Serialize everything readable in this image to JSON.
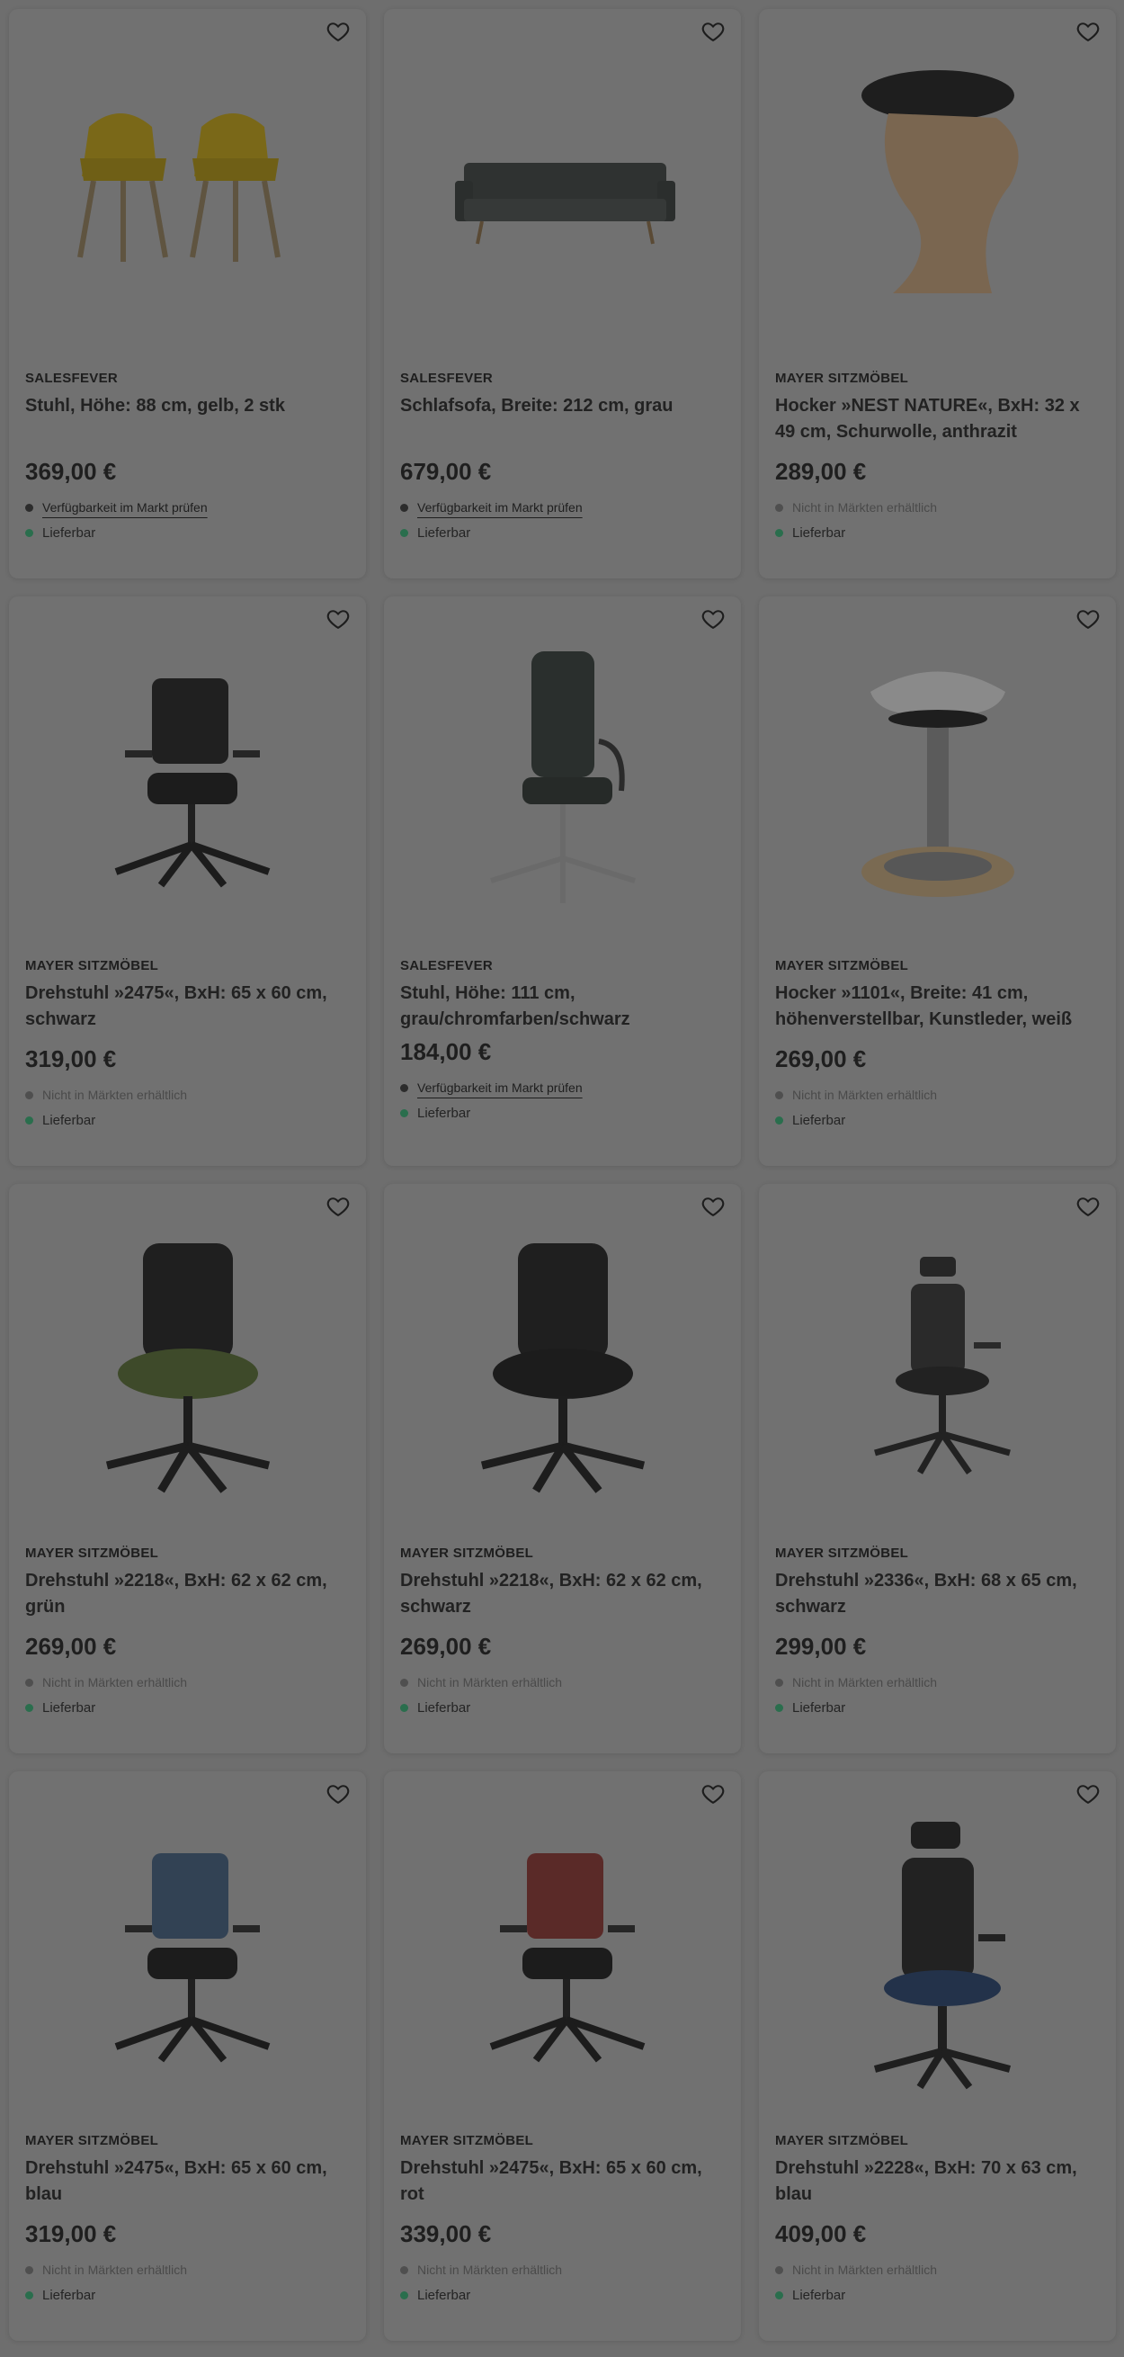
{
  "products": [
    {
      "brand": "SALESFEVER",
      "title": "Stuhl, Höhe: 88 cm, gelb, 2 stk",
      "price": "369,00 €",
      "availability": "Verfügbarkeit im Markt prüfen",
      "availability_type": "check",
      "delivery": "Lieferbar",
      "image": "yellow-armchair-pair"
    },
    {
      "brand": "SALESFEVER",
      "title": "Schlafsofa, Breite: 212 cm, grau",
      "price": "679,00 €",
      "availability": "Verfügbarkeit im Markt prüfen",
      "availability_type": "check",
      "delivery": "Lieferbar",
      "image": "grey-sofa-bed"
    },
    {
      "brand": "MAYER SITZMÖBEL",
      "title": "Hocker »NEST NATURE«, BxH: 32 x 49 cm, Schurwolle, anthrazit",
      "price": "289,00 €",
      "availability": "Nicht in Märkten erhältlich",
      "availability_type": "none",
      "delivery": "Lieferbar",
      "image": "wooden-stool"
    },
    {
      "brand": "MAYER SITZMÖBEL",
      "title": "Drehstuhl »2475«, BxH: 65 x 60 cm, schwarz",
      "price": "319,00 €",
      "availability": "Nicht in Märkten erhältlich",
      "availability_type": "none",
      "delivery": "Lieferbar",
      "image": "office-chair-black"
    },
    {
      "brand": "SALESFEVER",
      "title": "Stuhl, Höhe: 111 cm, grau/chromfarben/schwarz",
      "price": "184,00 €",
      "availability": "Verfügbarkeit im Markt prüfen",
      "availability_type": "check",
      "delivery": "Lieferbar",
      "image": "office-chair-highback-chrome"
    },
    {
      "brand": "MAYER SITZMÖBEL",
      "title": "Hocker »1101«, Breite: 41 cm, höhenverstellbar, Kunstleder, weiß",
      "price": "269,00 €",
      "availability": "Nicht in Märkten erhältlich",
      "availability_type": "none",
      "delivery": "Lieferbar",
      "image": "saddle-stool-white"
    },
    {
      "brand": "MAYER SITZMÖBEL",
      "title": "Drehstuhl »2218«, BxH: 62 x 62 cm, grün",
      "price": "269,00 €",
      "availability": "Nicht in Märkten erhältlich",
      "availability_type": "none",
      "delivery": "Lieferbar",
      "image": "office-chair-green"
    },
    {
      "brand": "MAYER SITZMÖBEL",
      "title": "Drehstuhl »2218«, BxH: 62 x 62 cm, schwarz",
      "price": "269,00 €",
      "availability": "Nicht in Märkten erhältlich",
      "availability_type": "none",
      "delivery": "Lieferbar",
      "image": "office-chair-black-mesh"
    },
    {
      "brand": "MAYER SITZMÖBEL",
      "title": "Drehstuhl »2336«, BxH: 68 x 65 cm, schwarz",
      "price": "299,00 €",
      "availability": "Nicht in Märkten erhältlich",
      "availability_type": "none",
      "delivery": "Lieferbar",
      "image": "office-chair-headrest-black"
    },
    {
      "brand": "MAYER SITZMÖBEL",
      "title": "Drehstuhl »2475«, BxH: 65 x 60 cm, blau",
      "price": "319,00 €",
      "availability": "Nicht in Märkten erhältlich",
      "availability_type": "none",
      "delivery": "Lieferbar",
      "image": "office-chair-blue-back"
    },
    {
      "brand": "MAYER SITZMÖBEL",
      "title": "Drehstuhl »2475«, BxH: 65 x 60 cm, rot",
      "price": "339,00 €",
      "availability": "Nicht in Märkten erhältlich",
      "availability_type": "none",
      "delivery": "Lieferbar",
      "image": "office-chair-red-back"
    },
    {
      "brand": "MAYER SITZMÖBEL",
      "title": "Drehstuhl »2228«, BxH: 70 x 63 cm, blau",
      "price": "409,00 €",
      "availability": "Nicht in Märkten erhältlich",
      "availability_type": "none",
      "delivery": "Lieferbar",
      "image": "office-chair-headrest-blue"
    }
  ],
  "icons": {
    "wishlist": "heart-outline-icon"
  },
  "colors": {
    "overlay": "#6e6e6e",
    "card": "#717171",
    "delivery_dot": "#2a6e4d"
  }
}
